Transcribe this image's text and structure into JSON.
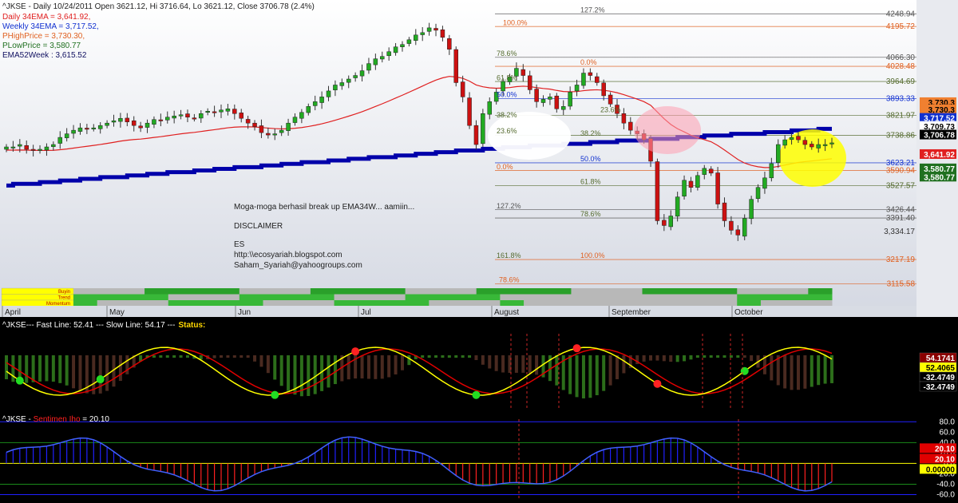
{
  "header": {
    "line": "^JKSE - Daily 10/24/2011 Open 3621.12, Hi 3716.64, Lo 3621.12, Close 3706.78 (2.4%)"
  },
  "indicators": [
    {
      "label": "Daily 34EMA = 3,641.92,",
      "color": "#e02020"
    },
    {
      "label": "Weekly 34EMA = 3,717.52,",
      "color": "#1030d0"
    },
    {
      "label": "PHighPrice = 3,730.30,",
      "color": "#e06020"
    },
    {
      "label": "PLowPrice = 3,580.77",
      "color": "#207020"
    },
    {
      "label": "EMA52Week : 3,615.52",
      "color": "#101060"
    }
  ],
  "annotations": {
    "message": "Moga-moga berhasil break up EMA34W... aamiin...",
    "disclaimer": "DISCLAIMER",
    "author": "ES",
    "blog": "http:\\\\ecosyariah.blogspot.com",
    "email": "Saham_Syariah@yahoogroups.com"
  },
  "months": [
    "April",
    "May",
    "Jun",
    "Jul",
    "August",
    "September",
    "October"
  ],
  "ribbon_labels": [
    "Buyin",
    "Trend",
    "Momentum"
  ],
  "price_panel": {
    "axis_labels": [
      {
        "text": "4248.94",
        "y": 4248.94,
        "color": "#555555"
      },
      {
        "text": "4195.72",
        "y": 4195.72,
        "color": "#e06020"
      },
      {
        "text": "4066.30",
        "y": 4066.3,
        "color": "#555555"
      },
      {
        "text": "4028.48",
        "y": 4028.48,
        "color": "#e06020"
      },
      {
        "text": "3964.69",
        "y": 3964.69,
        "color": "#556b2f"
      },
      {
        "text": "3893.33",
        "y": 3893.33,
        "color": "#1030d0"
      },
      {
        "text": "3821.97",
        "y": 3821.97,
        "color": "#556b2f"
      },
      {
        "text": "3738.86",
        "y": 3738.86,
        "color": "#556b2f"
      },
      {
        "text": "3623.21",
        "y": 3623.21,
        "color": "#1030d0"
      },
      {
        "text": "3590.94",
        "y": 3590.94,
        "color": "#e06020"
      },
      {
        "text": "3527.57",
        "y": 3527.57,
        "color": "#556b2f"
      },
      {
        "text": "3426.44",
        "y": 3426.44,
        "color": "#555555"
      },
      {
        "text": "3391.40",
        "y": 3391.4,
        "color": "#555555"
      },
      {
        "text": "3,334.17",
        "y": 3334.17,
        "color": "#333333"
      },
      {
        "text": "3217.19",
        "y": 3217.19,
        "color": "#e06020"
      },
      {
        "text": "3115.58",
        "y": 3115.58,
        "color": "#e06020"
      }
    ],
    "tags": [
      {
        "text": "3,730.3",
        "y": 3878,
        "bg": "#f08030",
        "fg": "#000000"
      },
      {
        "text": "3,730.3",
        "y": 3848,
        "bg": "#f08030",
        "fg": "#000000"
      },
      {
        "text": "3,717.52",
        "y": 3812,
        "bg": "#1030d0",
        "fg": "#ffffff"
      },
      {
        "text": "3,709.73",
        "y": 3778,
        "bg": "#ffffff",
        "fg": "#000000"
      },
      {
        "text": "3,706.78",
        "y": 3742,
        "bg": "#000000",
        "fg": "#ffffff"
      },
      {
        "text": "3,641.92",
        "y": 3660,
        "bg": "#e02020",
        "fg": "#ffffff"
      },
      {
        "text": "3,580.77",
        "y": 3600,
        "bg": "#207020",
        "fg": "#ffffff"
      },
      {
        "text": "3,580.77",
        "y": 3565,
        "bg": "#207020",
        "fg": "#ffffff"
      }
    ],
    "fib_labels": [
      {
        "text": "127.2%",
        "x": 727,
        "y": 4248,
        "color": "#555555"
      },
      {
        "text": "100.0%",
        "x": 630,
        "y": 4195,
        "color": "#e06020"
      },
      {
        "text": "78.6%",
        "x": 622,
        "y": 4066,
        "color": "#556b2f"
      },
      {
        "text": "0.0%",
        "x": 727,
        "y": 4028,
        "color": "#e06020"
      },
      {
        "text": "61.8%",
        "x": 622,
        "y": 3964,
        "color": "#556b2f"
      },
      {
        "text": "50.0%",
        "x": 622,
        "y": 3893,
        "color": "#1030d0"
      },
      {
        "text": "23.6%",
        "x": 752,
        "y": 3830,
        "color": "#556b2f"
      },
      {
        "text": "38.2%",
        "x": 622,
        "y": 3808,
        "color": "#556b2f"
      },
      {
        "text": "23.6%",
        "x": 622,
        "y": 3740,
        "color": "#556b2f"
      },
      {
        "text": "38.2%",
        "x": 727,
        "y": 3730,
        "color": "#556b2f"
      },
      {
        "text": "50.0%",
        "x": 727,
        "y": 3623,
        "color": "#1030d0"
      },
      {
        "text": "0.0%",
        "x": 622,
        "y": 3590,
        "color": "#e06020"
      },
      {
        "text": "61.8%",
        "x": 727,
        "y": 3527,
        "color": "#556b2f"
      },
      {
        "text": "127.2%",
        "x": 622,
        "y": 3426,
        "color": "#555555"
      },
      {
        "text": "78.6%",
        "x": 727,
        "y": 3391,
        "color": "#556b2f"
      },
      {
        "text": "161.8%",
        "x": 622,
        "y": 3217,
        "color": "#556b2f"
      },
      {
        "text": "100.0%",
        "x": 727,
        "y": 3217,
        "color": "#e06020"
      },
      {
        "text": "78.6%",
        "x": 625,
        "y": 3115,
        "color": "#e06020"
      }
    ]
  },
  "panel2": {
    "title_parts": [
      "^JKSE--- Fast Line: 52.41 --- Slow Line: 54.17 ---",
      "Status:"
    ],
    "title_colors": [
      "#ffffff",
      "#ffd700"
    ],
    "tags": [
      {
        "text": "54.1741",
        "bg": "#8b0000",
        "fg": "#ffffff",
        "row": 0
      },
      {
        "text": "52.4065",
        "bg": "#ffff00",
        "fg": "#000000",
        "row": 1
      },
      {
        "text": "-32.4749",
        "bg": "#000000",
        "fg": "#ffffff",
        "row": 2
      },
      {
        "text": "-32.4749",
        "bg": "#000000",
        "fg": "#ffffff",
        "row": 3
      }
    ]
  },
  "panel3": {
    "title_parts": [
      "^JKSE - ",
      "Sentimen Iho",
      " = 20.10"
    ],
    "title_colors": [
      "#ffffff",
      "#ff2020",
      "#ffffff"
    ],
    "axis_labels": [
      "80.0",
      "60.0",
      "40.0",
      "20.0",
      "0.0",
      "-20.0",
      "-40.0",
      "-60.0"
    ],
    "tags": [
      {
        "text": "20.10",
        "bg": "#e00000",
        "fg": "#ffffff",
        "row": 0
      },
      {
        "text": "20.10",
        "bg": "#e00000",
        "fg": "#ffffff",
        "row": 1
      },
      {
        "text": "0.00000",
        "bg": "#ffff00",
        "fg": "#000000",
        "row": 2
      }
    ]
  },
  "colors": {
    "bull": "#22aa22",
    "bear": "#cc1111",
    "ema_daily": "#e02020",
    "ema_weekly": "#0000aa",
    "fast_line": "#ffff00",
    "slow_line": "#e00000",
    "blue_line": "#1040ff",
    "panel_bg_top": "#ffffff",
    "panel_bg_bottom": "#d8dce4"
  },
  "chart_data": {
    "type": "candlestick",
    "ylabel": "",
    "ylim": [
      3100,
      4260
    ],
    "x_months": [
      "April",
      "May",
      "Jun",
      "Jul",
      "August",
      "September",
      "October"
    ],
    "price_levels": {
      "daily_34ema": 3641.92,
      "weekly_34ema": 3717.52,
      "p_high_price": 3730.3,
      "p_low_price": 3580.77,
      "ema_52week": 3615.52,
      "last_close": 3706.78,
      "last_open": 3621.12,
      "last_high": 3716.64,
      "last_low": 3621.12
    },
    "close_series": [
      3690,
      3690,
      3700,
      3680,
      3675,
      3680,
      3690,
      3700,
      3730,
      3745,
      3760,
      3770,
      3765,
      3770,
      3780,
      3790,
      3800,
      3810,
      3795,
      3780,
      3770,
      3790,
      3805,
      3800,
      3815,
      3820,
      3825,
      3815,
      3810,
      3830,
      3840,
      3835,
      3845,
      3850,
      3830,
      3810,
      3790,
      3775,
      3750,
      3740,
      3745,
      3760,
      3790,
      3815,
      3835,
      3860,
      3880,
      3900,
      3925,
      3950,
      3960,
      3975,
      3990,
      4010,
      4040,
      4060,
      4070,
      4090,
      4110,
      4120,
      4140,
      4160,
      4170,
      4190,
      4180,
      4150,
      4100,
      3960,
      3900,
      3780,
      3700,
      3830,
      3880,
      3920,
      3965,
      3985,
      4020,
      3990,
      3930,
      3880,
      3890,
      3900,
      3850,
      3860,
      3920,
      3950,
      4000,
      3990,
      3960,
      3905,
      3870,
      3830,
      3790,
      3760,
      3745,
      3720,
      3630,
      3380,
      3360,
      3400,
      3480,
      3550,
      3520,
      3570,
      3600,
      3580,
      3450,
      3380,
      3340,
      3320,
      3390,
      3470,
      3520,
      3560,
      3620,
      3700,
      3720,
      3730,
      3720,
      3700,
      3690,
      3700,
      3700,
      3707
    ],
    "panel2": {
      "fast_line_last": 52.41,
      "slow_line_last": 54.17,
      "histogram_last": -32.4749
    },
    "panel3": {
      "sentimen_iho": 20.1,
      "ylim": [
        -70,
        85
      ]
    }
  }
}
